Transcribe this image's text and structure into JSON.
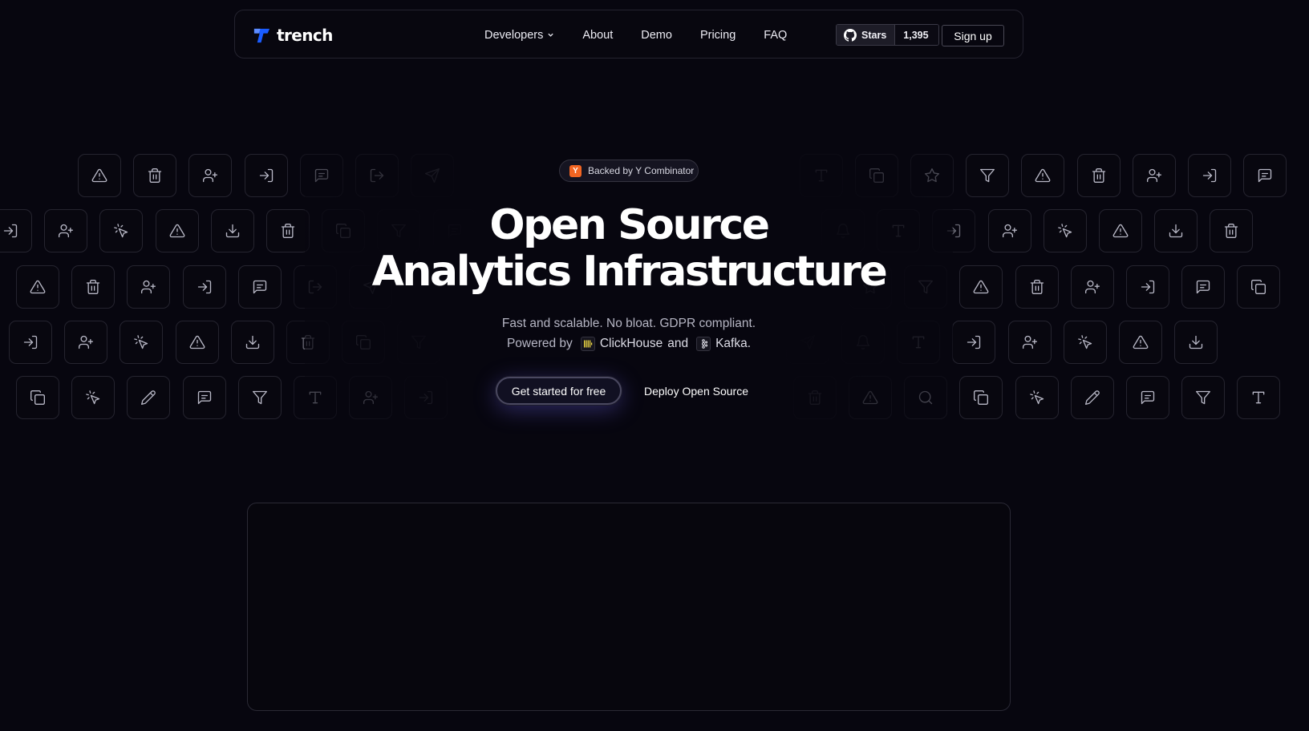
{
  "nav": {
    "logo_text": "trench",
    "links": [
      {
        "label": "Developers",
        "has_dropdown": true
      },
      {
        "label": "About"
      },
      {
        "label": "Demo"
      },
      {
        "label": "Pricing"
      },
      {
        "label": "FAQ"
      }
    ],
    "github": {
      "label": "Stars",
      "count": "1,395",
      "icon": "github-icon"
    },
    "signup_label": "Sign up"
  },
  "hero": {
    "badge": {
      "icon_letter": "Y",
      "text": "Backed by Y Combinator"
    },
    "headline_line1": "Open Source",
    "headline_line2": "Analytics Infrastructure",
    "subtitle": "Fast and scalable. No bloat. GDPR compliant.",
    "powered_prefix": "Powered by",
    "clickhouse": "ClickHouse",
    "and": "and",
    "kafka": "Kafka.",
    "cta_primary": "Get started for free",
    "cta_secondary": "Deploy Open Source"
  },
  "colors": {
    "background": "#07060f",
    "brand_blue": "#1a5cff",
    "yc_orange": "#f26522",
    "clickhouse_yellow": "#f7e045"
  },
  "background_icons": [
    "alert-triangle-icon",
    "trash-icon",
    "user-plus-icon",
    "log-in-icon",
    "message-square-icon",
    "log-out-icon",
    "send-icon",
    "type-icon",
    "copy-icon",
    "star-icon",
    "filter-icon",
    "pointer-click-icon",
    "download-icon",
    "bell-icon",
    "pencil-icon",
    "search-icon"
  ]
}
